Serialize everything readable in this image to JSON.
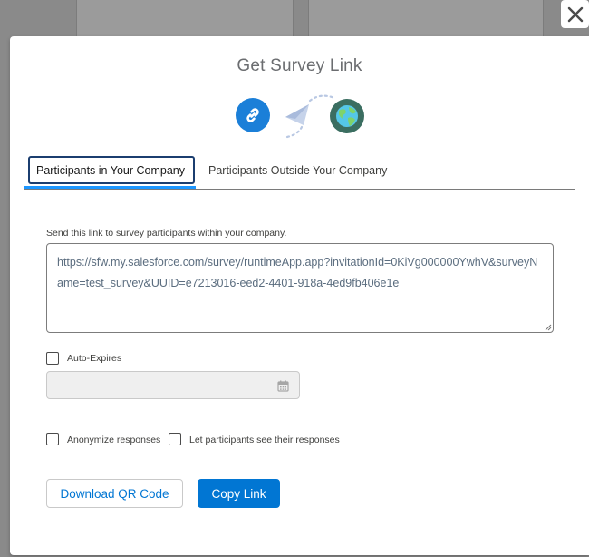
{
  "modal": {
    "title": "Get Survey Link",
    "close_label": "Close",
    "icons": [
      "link-icon",
      "paper-plane-icon",
      "globe-icon"
    ]
  },
  "tabs": [
    {
      "label": "Participants in Your Company",
      "active": true
    },
    {
      "label": "Participants Outside Your Company",
      "active": false
    }
  ],
  "link_section": {
    "description": "Send this link to survey participants within your company.",
    "url": "https://sfw.my.salesforce.com/survey/runtimeApp.app?invitationId=0KiVg000000YwhV&surveyName=test_survey&UUID=e7213016-eed2-4401-918a-4ed9fb406e1e"
  },
  "auto_expires": {
    "label": "Auto-Expires",
    "checked": false,
    "date_value": ""
  },
  "options": {
    "anonymize_label": "Anonymize responses",
    "anonymize_checked": false,
    "see_responses_label": "Let participants see their responses",
    "see_responses_checked": false
  },
  "buttons": {
    "download_qr": "Download QR Code",
    "copy_link": "Copy Link"
  },
  "colors": {
    "brand": "#0176d3",
    "link_icon_bg": "#1b7fd8",
    "globe_icon_bg": "#3b6e61",
    "active_tab_underline": "#1b96ff"
  }
}
